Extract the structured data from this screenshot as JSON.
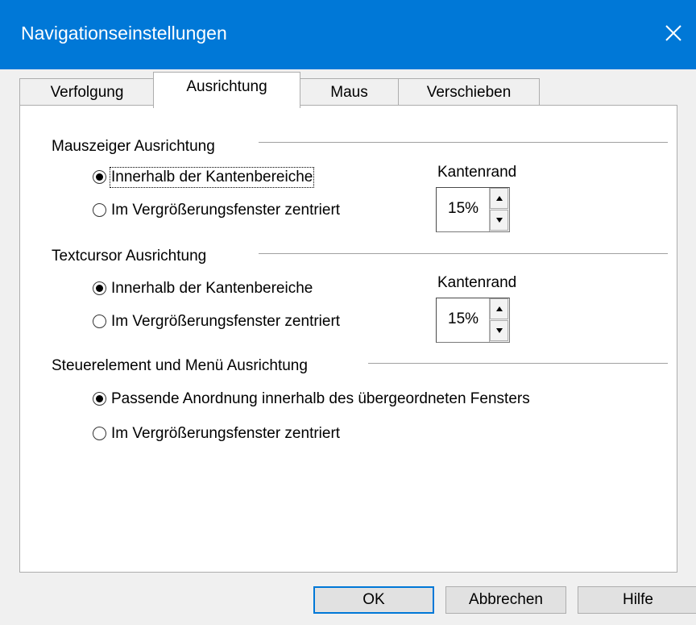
{
  "window": {
    "title": "Navigationseinstellungen"
  },
  "tabs": [
    {
      "label": "Verfolgung",
      "active": false
    },
    {
      "label": "Ausrichtung",
      "active": true
    },
    {
      "label": "Maus",
      "active": false
    },
    {
      "label": "Verschieben",
      "active": false
    }
  ],
  "groups": {
    "mouse": {
      "title": "Mauszeiger Ausrichtung",
      "options": [
        {
          "label": "Innerhalb der Kantenbereiche",
          "selected": true
        },
        {
          "label": "Im Vergrößerungsfenster zentriert",
          "selected": false
        }
      ],
      "edge_label": "Kantenrand",
      "edge_value": "15%"
    },
    "text": {
      "title": "Textcursor Ausrichtung",
      "options": [
        {
          "label": "Innerhalb der Kantenbereiche",
          "selected": true
        },
        {
          "label": "Im Vergrößerungsfenster zentriert",
          "selected": false
        }
      ],
      "edge_label": "Kantenrand",
      "edge_value": "15%"
    },
    "control": {
      "title": "Steuerelement und Menü Ausrichtung",
      "options": [
        {
          "label": "Passende Anordnung innerhalb des übergeordneten Fensters",
          "selected": true
        },
        {
          "label": "Im Vergrößerungsfenster zentriert",
          "selected": false
        }
      ]
    }
  },
  "buttons": {
    "ok": "OK",
    "cancel": "Abbrechen",
    "help": "Hilfe"
  },
  "colors": {
    "titlebar": "#0078d7",
    "default_button_border": "#0078d7"
  },
  "icons": {
    "close": "close-icon",
    "spin_up": "arrow-up-icon",
    "spin_down": "arrow-down-icon"
  }
}
